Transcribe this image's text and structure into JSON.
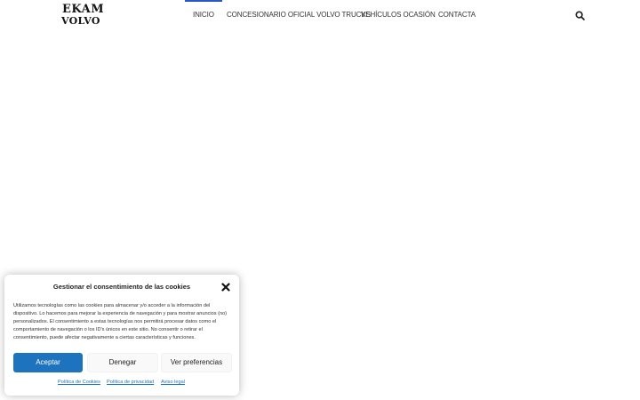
{
  "logo": {
    "line1": "EKAM",
    "line2": "VOLVO"
  },
  "nav": {
    "items": [
      {
        "label": "INICIO",
        "active": true
      },
      {
        "label": "CONCESIONARIO OFICIAL VOLVO TRUCKS",
        "active": false
      },
      {
        "label": "VEHÍCULOS OCASIÓN",
        "active": false
      },
      {
        "label": "CONTACTA",
        "active": false
      }
    ],
    "search_icon": "search-icon"
  },
  "cookie_banner": {
    "title": "Gestionar el consentimiento de las cookies",
    "close_icon": "close-icon",
    "body": "Utilizamos tecnologías como las cookies para almacenar y/o acceder a la información del dispositivo. Lo hacemos para mejorar la experiencia de navegación y para mostrar anuncios (no) personalizados. El consentimiento a estas tecnologías nos permitirá procesar datos como el comportamiento de navegación o los ID's únicos en este sitio. No consentir o retirar el consentimiento, puede afectar negativamente a ciertas características y funciones.",
    "buttons": {
      "accept": "Aceptar",
      "deny": "Denegar",
      "preferences": "Ver preferencias"
    },
    "links": {
      "cookies": "Política de Cookies",
      "privacy": "Política de privacidad",
      "legal": "Aviso legal"
    }
  },
  "colors": {
    "accent": "#1e73be",
    "nav_active_bar": "#2a56c6"
  }
}
